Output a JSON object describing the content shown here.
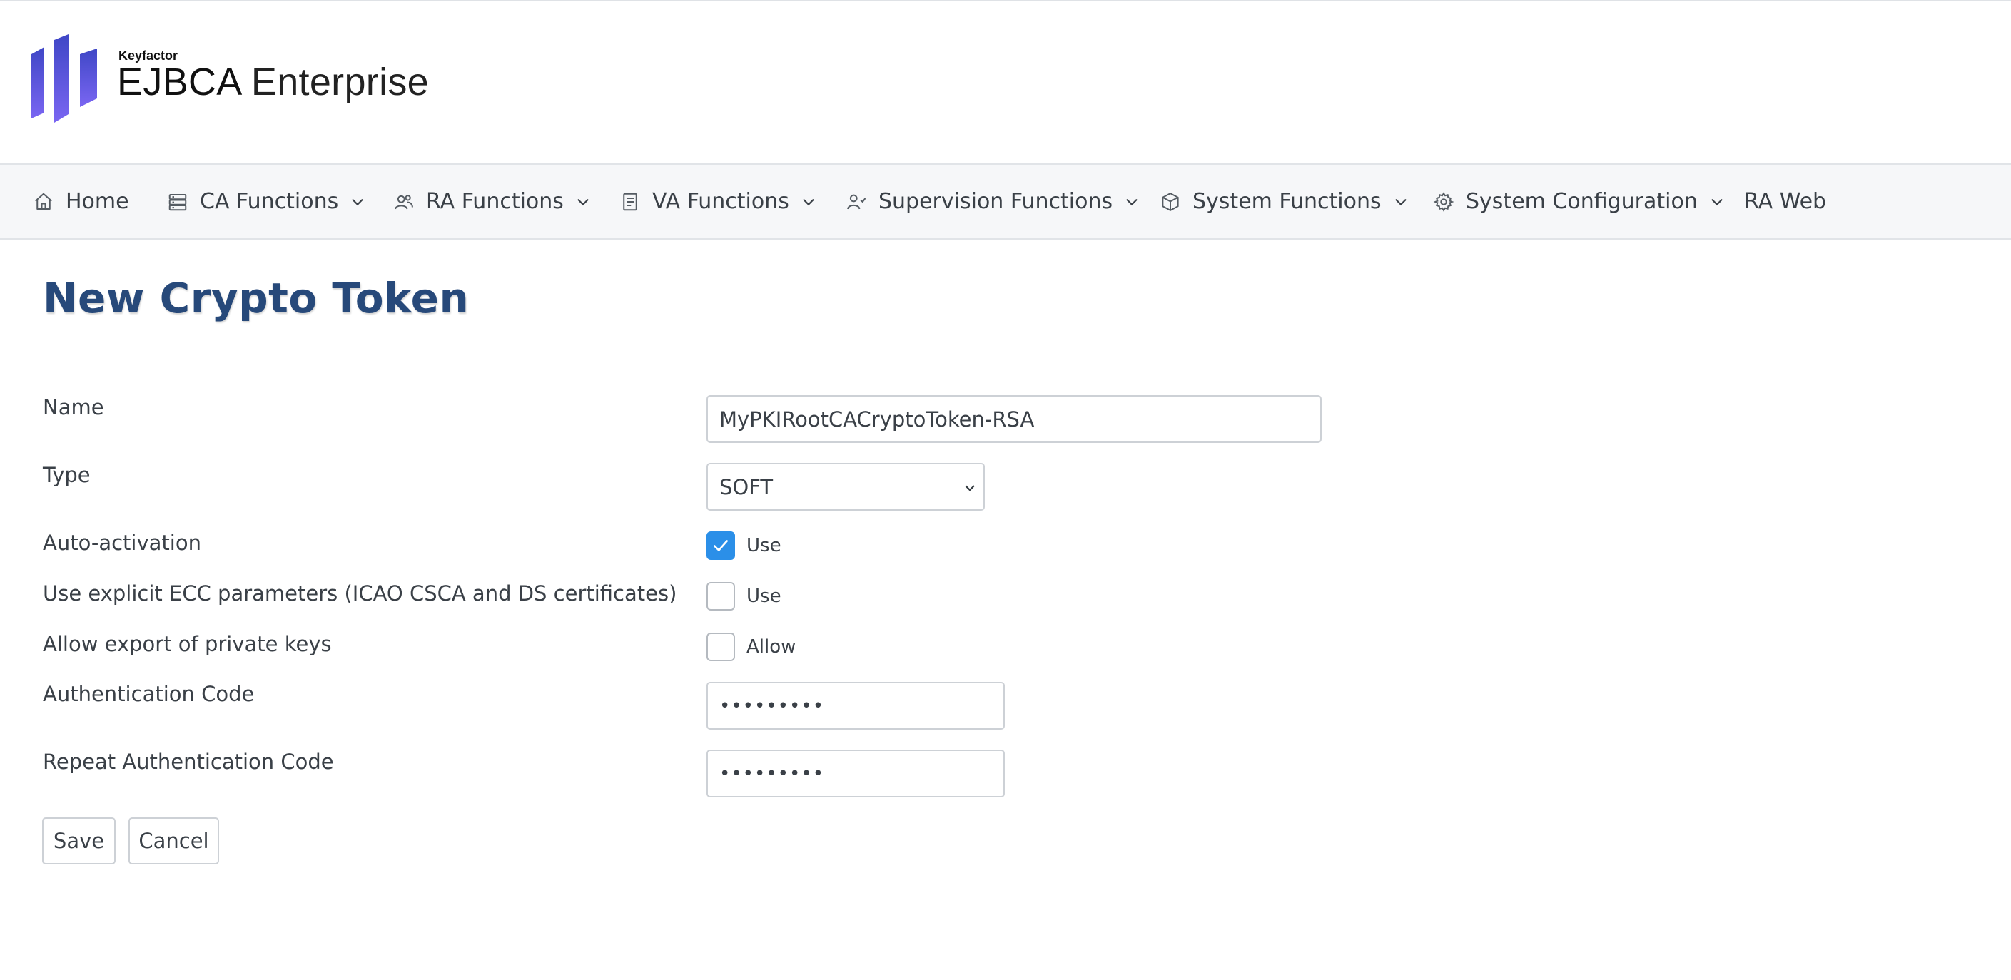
{
  "brand": {
    "company": "Keyfactor",
    "product": "EJBCA",
    "edition": "Enterprise",
    "colors": {
      "mark_start": "#3f47c6",
      "mark_end": "#7a66f2"
    }
  },
  "nav": {
    "items": [
      {
        "label": "Home",
        "icon": "home-icon"
      },
      {
        "label": "CA Functions",
        "icon": "server-icon"
      },
      {
        "label": "RA Functions",
        "icon": "users-icon"
      },
      {
        "label": "VA Functions",
        "icon": "document-icon"
      },
      {
        "label": "Supervision Functions",
        "icon": "user-check-icon"
      },
      {
        "label": "System Functions",
        "icon": "cube-icon"
      },
      {
        "label": "System Configuration",
        "icon": "gear-icon"
      },
      {
        "label": "RA Web"
      }
    ]
  },
  "page": {
    "title": "New Crypto Token"
  },
  "form": {
    "name": {
      "label": "Name",
      "value": "MyPKIRootCACryptoToken-RSA"
    },
    "type": {
      "label": "Type",
      "value": "SOFT"
    },
    "auto_activation": {
      "label": "Auto-activation",
      "option": "Use",
      "checked": true
    },
    "explicit_ecc": {
      "label": "Use explicit ECC parameters (ICAO CSCA and DS certificates)",
      "option": "Use",
      "checked": false
    },
    "allow_export": {
      "label": "Allow export of private keys",
      "option": "Allow",
      "checked": false
    },
    "auth_code": {
      "label": "Authentication Code",
      "masked_value": "•••••••••"
    },
    "repeat_auth_code": {
      "label": "Repeat Authentication Code",
      "masked_value": "•••••••••"
    }
  },
  "actions": {
    "save": "Save",
    "cancel": "Cancel"
  },
  "colors": {
    "title": "#27497a",
    "checkbox_checked": "#2b8fe8",
    "navbar_bg": "#f6f7f9"
  }
}
